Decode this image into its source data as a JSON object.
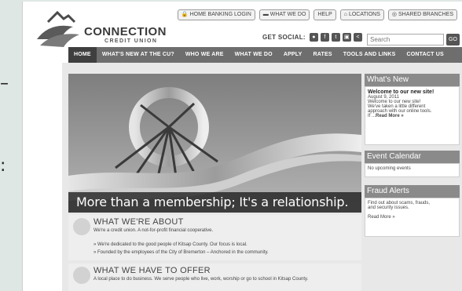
{
  "background_fragments": {
    "dash": "–",
    "colon": ":"
  },
  "logo": {
    "name": "CONNECTION",
    "subtitle": "CREDIT UNION"
  },
  "utility": [
    {
      "icon": "lock-icon",
      "glyph": "🔒",
      "label": "HOME BANKING LOGIN"
    },
    {
      "icon": "chat-icon",
      "glyph": "▬",
      "label": "WHAT WE DO"
    },
    {
      "icon": "help-icon",
      "glyph": "",
      "label": "HELP"
    },
    {
      "icon": "home-icon",
      "glyph": "⌂",
      "label": "LOCATIONS"
    },
    {
      "icon": "branch-icon",
      "glyph": "◎",
      "label": "SHARED BRANCHES"
    }
  ],
  "social": {
    "label": "GET SOCIAL:",
    "icons": [
      "●",
      "f",
      "t",
      "▣",
      "<"
    ]
  },
  "search": {
    "placeholder": "Search",
    "go": "GO"
  },
  "nav": [
    "HOME",
    "WHAT'S NEW AT THE CU?",
    "WHO WE ARE",
    "WHAT WE DO",
    "APPLY",
    "RATES",
    "TOOLS AND LINKS",
    "CONTACT US"
  ],
  "hero": {
    "tagline": "More than a membership; It's a relationship."
  },
  "sections": [
    {
      "title": "WHAT WE'RE ABOUT",
      "desc": "We're a credit union. A not-for-profit financial cooperative.",
      "bullets": [
        "» We're dedicated to the good people of Kitsap County.  Our focus is local.",
        "» Founded by the employees of the City of Bremerton – Anchored in the community."
      ]
    },
    {
      "title": "WHAT WE HAVE TO OFFER",
      "desc": "A local place to do business. We serve people who live, work, worship or go to school in Kitsap County.",
      "bullets": []
    }
  ],
  "sidebar": {
    "whats_new": {
      "heading": "What's New",
      "title": "Welcome to our new site!",
      "date": "August 9, 2011",
      "lines": [
        "Welcome to our new site!",
        "We've taken a little different",
        "approach with our online tools.",
        "If ..."
      ],
      "more": "Read More »"
    },
    "events": {
      "heading": "Event Calendar",
      "text": "No upcoming events"
    },
    "fraud": {
      "heading": "Fraud Alerts",
      "lines": [
        "Find out about scams, frauds,",
        "and security issues."
      ],
      "more": "Read More »"
    }
  }
}
